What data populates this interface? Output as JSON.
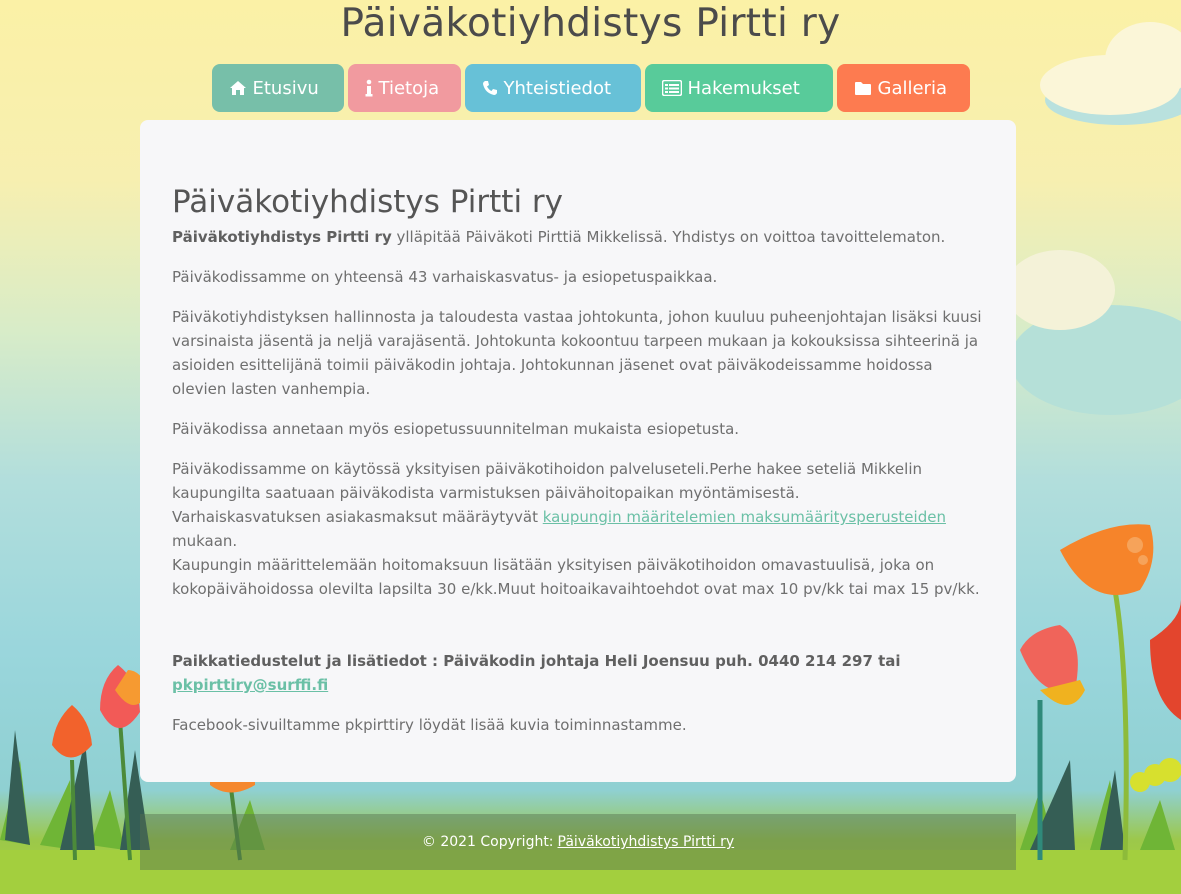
{
  "header": {
    "title": "Päiväkotiyhdistys Pirtti ry"
  },
  "nav": [
    {
      "label": "Etusivu",
      "icon": "home-icon",
      "color": "#77bfa9"
    },
    {
      "label": "Tietoja",
      "icon": "info-icon",
      "color": "#f19a9f"
    },
    {
      "label": "Yhteistiedot",
      "icon": "phone-icon",
      "color": "#67c1d7"
    },
    {
      "label": "Hakemukset",
      "icon": "list-icon",
      "color": "#58cb9a"
    },
    {
      "label": "Galleria",
      "icon": "folder-icon",
      "color": "#fd7b50"
    }
  ],
  "main": {
    "heading": "Päiväkotiyhdistys Pirtti ry",
    "intro_bold": "Päiväkotiyhdistys Pirtti ry",
    "intro_rest": " ylläpitää Päiväkoti Pirttiä Mikkelissä. Yhdistys on voittoa tavoittelematon.",
    "p2": "Päiväkodissamme on yhteensä 43 varhaiskasvatus- ja esiopetuspaikkaa.",
    "p3": "Päiväkotiyhdistyksen hallinnosta ja taloudesta vastaa johtokunta, johon kuuluu puheenjohtajan lisäksi kuusi varsinaista jäsentä ja neljä varajäsentä. Johtokunta kokoontuu tarpeen mukaan ja kokouksissa sihteerinä ja asioiden esittelijänä toimii päiväkodin johtaja. Johtokunnan jäsenet ovat päiväkodeissamme hoidossa olevien lasten vanhempia.",
    "p4": "Päiväkodissa annetaan myös esiopetussuunnitelman mukaista esiopetusta.",
    "p5_line1": "Päiväkodissamme on käytössä yksityisen päiväkotihoidon palveluseteli.Perhe hakee seteliä Mikkelin kaupungilta saatuaan päiväkodista varmistuksen päivähoitopaikan myöntämisestä.",
    "p5_pre_link": "Varhaiskasvatuksen asiakasmaksut määräytyvät ",
    "p5_link": "kaupungin määritelemien maksumääritysperusteiden",
    "p5_post_link": " mukaan.",
    "p5_line3": "Kaupungin määrittelemään hoitomaksuun lisätään yksityisen päiväkotihoidon omavastuulisä, joka on kokopäivähoidossa olevilta lapsilta 30 e/kk.Muut hoitoaikavaihtoehdot ovat max 10 pv/kk tai max 15 pv/kk.",
    "contact_text": "Paikkatiedustelut ja lisätiedot : Päiväkodin johtaja Heli Joensuu puh. 0440 214 297 tai ",
    "contact_email": "pkpirttiry@surffi.fi",
    "p_facebook": "Facebook-sivuiltamme pkpirttiry löydät lisää kuvia toiminnastamme."
  },
  "footer": {
    "copyright": "© 2021 Copyright:",
    "link": "Päiväkotiyhdistys Pirtti ry"
  }
}
